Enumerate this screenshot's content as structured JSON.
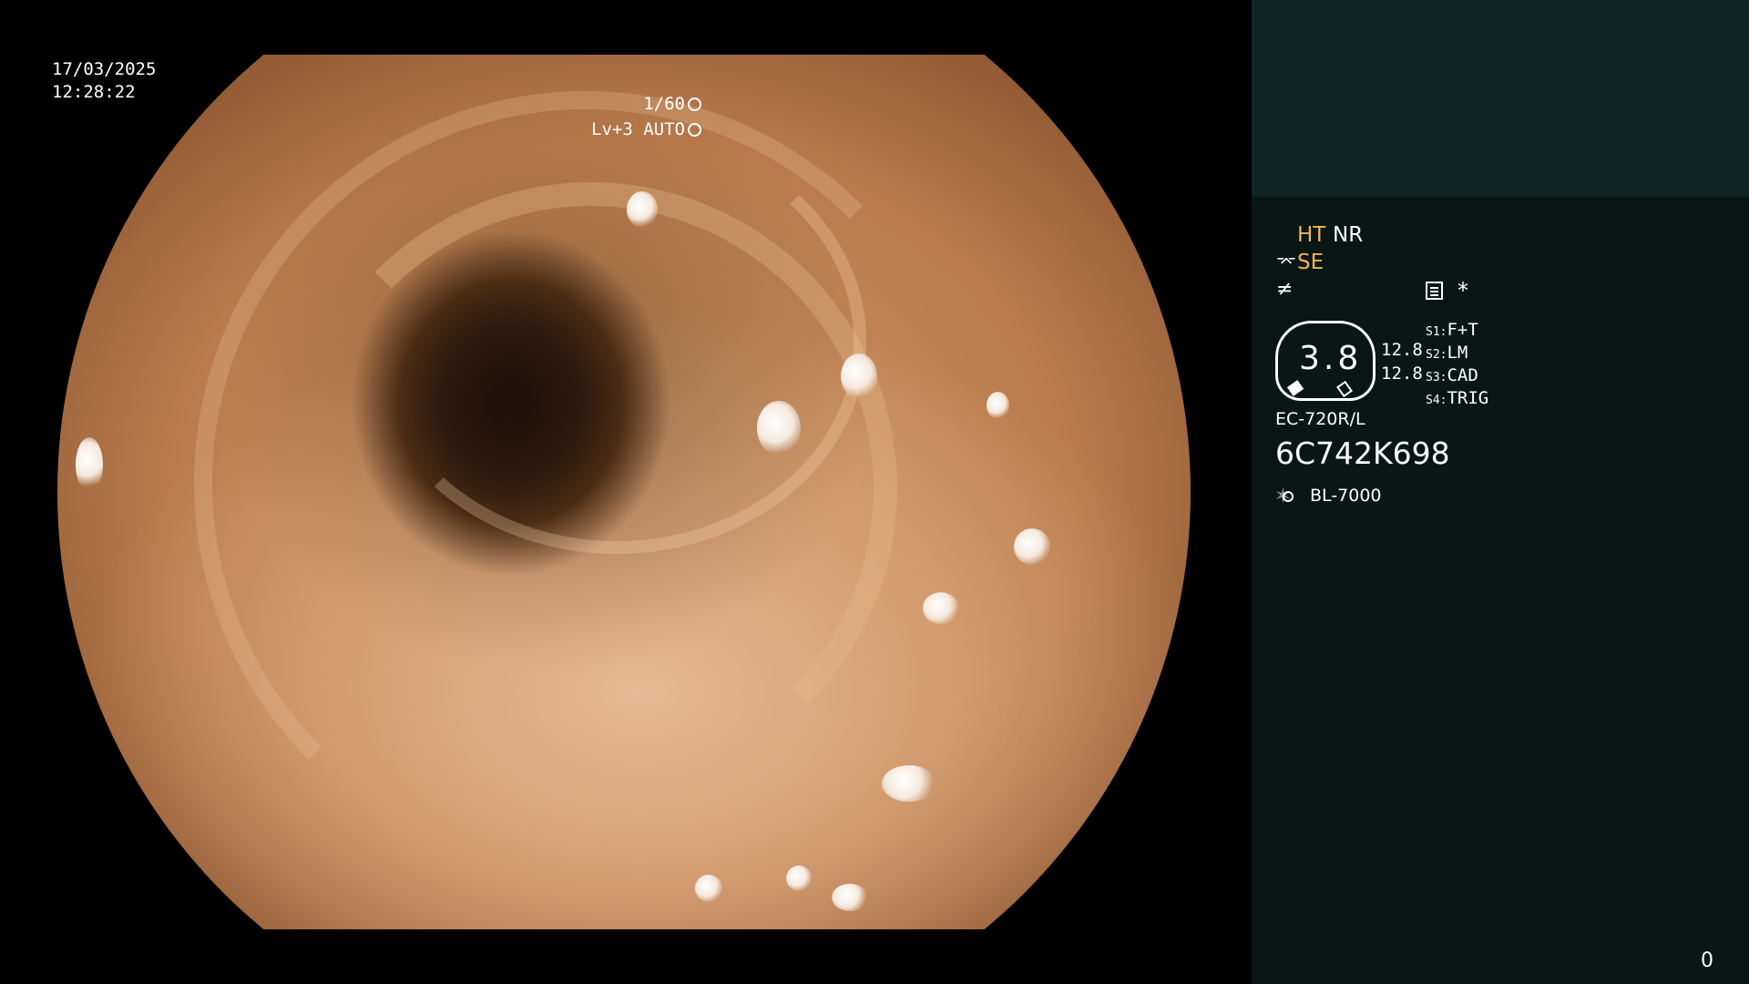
{
  "timestamp": {
    "date": "17/03/2025",
    "time": "12:28:22"
  },
  "exposure": {
    "shutter": "1/60",
    "shutter_icon": "aperture-icon",
    "level": "Lv+3 AUTO",
    "level_icon": "iris-icon"
  },
  "panel": {
    "modes": {
      "ht": "HT",
      "nr": "NR",
      "se": "SE",
      "se_icon": "se-icon",
      "filter_icon": "not-equal-filter-icon",
      "doc_icon": "document-icon",
      "star": "*"
    },
    "gauge": {
      "value": "3.8",
      "left_reading": "12.8",
      "right_reading": "12.8"
    },
    "switches": [
      {
        "key": "S1",
        "value": "F+T"
      },
      {
        "key": "S2",
        "value": "LM"
      },
      {
        "key": "S3",
        "value": "CAD"
      },
      {
        "key": "S4",
        "value": "TRIG"
      }
    ],
    "scope_model": "EC-720R/L",
    "serial": "6C742K698",
    "light_source": "BL-7000",
    "light_icon": "sun-icon",
    "counter": "0"
  },
  "colors": {
    "panel_top": "#0e2523",
    "panel": "#081614",
    "accent": "#f2b45a"
  }
}
